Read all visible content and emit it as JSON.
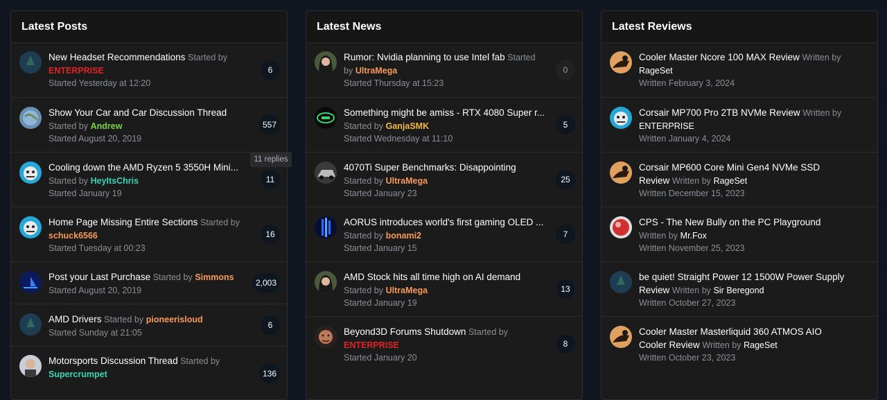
{
  "colors": {
    "red": "#e02424",
    "green": "#7bd448",
    "teal": "#3ad3b6",
    "orange": "#f59a5a",
    "yellow": "#f2b84b",
    "white": "#ffffff"
  },
  "latest_posts": {
    "title": "Latest Posts",
    "tooltip": "11 replies",
    "items": [
      {
        "title": "New Headset Recommendations",
        "by_label": "Started by",
        "user": "ENTERPRISE",
        "user_color": "red",
        "when": "Started Yesterday at 12:20",
        "count": "6",
        "avatar_icon": "tree-avatar-icon"
      },
      {
        "title": "Show Your Car and Car Discussion Thread",
        "by_label": "Started by",
        "user": "Andrew",
        "user_color": "green",
        "when": "Started August 20, 2019",
        "count": "557",
        "avatar_icon": "globe-avatar-icon"
      },
      {
        "title": "Cooling down the AMD Ryzen 5 3550H Mini...",
        "by_label": "Started by",
        "user": "HeyItsChris",
        "user_color": "teal",
        "when": "Started January 19",
        "count": "11",
        "avatar_icon": "tiger-avatar-icon"
      },
      {
        "title": "Home Page Missing Entire Sections",
        "by_label": "Started by",
        "user": "schuck6566",
        "user_color": "orange",
        "when": "Started Tuesday at 00:23",
        "count": "16",
        "avatar_icon": "tiger-avatar-icon"
      },
      {
        "title": "Post your Last Purchase",
        "by_label": "Started by",
        "user": "Simmons",
        "user_color": "orange",
        "when": "Started August 20, 2019",
        "count": "2,003",
        "avatar_icon": "sailboat-avatar-icon"
      },
      {
        "title": "AMD Drivers",
        "by_label": "Started by",
        "user": "pioneerisloud",
        "user_color": "orange",
        "when": "Started Sunday at 21:05",
        "count": "6",
        "avatar_icon": "tree-avatar-icon"
      },
      {
        "title": "Motorsports Discussion Thread",
        "by_label": "Started by",
        "user": "Supercrumpet",
        "user_color": "teal",
        "when": "",
        "count": "136",
        "avatar_icon": "person-avatar-icon"
      }
    ]
  },
  "latest_news": {
    "title": "Latest News",
    "items": [
      {
        "title": "Rumor: Nvidia planning to use Intel fab",
        "by_label": "Started by",
        "user": "UltraMega",
        "user_color": "orange",
        "when": "Started Thursday at 15:23",
        "count": "0",
        "avatar_icon": "woman-avatar-icon"
      },
      {
        "title": "Something might be amiss - RTX 4080 Super r...",
        "by_label": "Started by",
        "user": "GanjaSMK",
        "user_color": "yellow",
        "when": "Started Wednesday at 11:10",
        "count": "5",
        "avatar_icon": "badge-avatar-icon"
      },
      {
        "title": "4070Ti Super Benchmarks: Disappointing",
        "by_label": "Started by",
        "user": "UltraMega",
        "user_color": "orange",
        "when": "Started January 23",
        "count": "25",
        "avatar_icon": "car-avatar-icon"
      },
      {
        "title": "AORUS introduces world's first gaming OLED ...",
        "by_label": "Started by",
        "user": "bonami2",
        "user_color": "orange",
        "when": "Started January 15",
        "count": "7",
        "avatar_icon": "blue-light-avatar-icon"
      },
      {
        "title": "AMD Stock hits all time high on AI demand",
        "by_label": "Started by",
        "user": "UltraMega",
        "user_color": "orange",
        "when": "Started January 19",
        "count": "13",
        "avatar_icon": "woman-avatar-icon"
      },
      {
        "title": "Beyond3D Forums Shutdown",
        "by_label": "Started by",
        "user": "ENTERPRISE",
        "user_color": "red",
        "when": "Started January 20",
        "count": "8",
        "avatar_icon": "face-avatar-icon"
      }
    ]
  },
  "latest_reviews": {
    "title": "Latest Reviews",
    "items": [
      {
        "title": "Cooler Master Ncore 100 MAX Review",
        "by_label": "Written by",
        "user": "RageSet",
        "user_color": "white",
        "when": "Written February 3, 2024",
        "avatar_icon": "rider-avatar-icon"
      },
      {
        "title": "Corsair MP700 Pro 2TB NVMe Review",
        "by_label": "Written by",
        "user": "ENTERPRISE",
        "user_color": "white",
        "when": "Written January 4, 2024",
        "avatar_icon": "tiger-avatar-icon"
      },
      {
        "title": "Corsair MP600 Core Mini Gen4 NVMe SSD Review",
        "by_label": "Written by",
        "user": "RageSet",
        "user_color": "white",
        "when": "Written December 15, 2023",
        "avatar_icon": "rider-avatar-icon"
      },
      {
        "title": "CPS - The New Bully on the PC Playground",
        "by_label": "Written by",
        "user": "Mr.Fox",
        "user_color": "white",
        "when": "Written November 25, 2023",
        "avatar_icon": "ball-avatar-icon"
      },
      {
        "title": "be quiet! Straight Power 12 1500W Power Supply Review",
        "by_label": "Written by",
        "user": "Sir Beregond",
        "user_color": "white",
        "when": "Written October 27, 2023",
        "avatar_icon": "tree-avatar-icon"
      },
      {
        "title": "Cooler Master Masterliquid 360 ATMOS AIO Cooler Review",
        "by_label": "Written by",
        "user": "RageSet",
        "user_color": "white",
        "when": "Written October 23, 2023",
        "avatar_icon": "rider-avatar-icon"
      }
    ]
  }
}
